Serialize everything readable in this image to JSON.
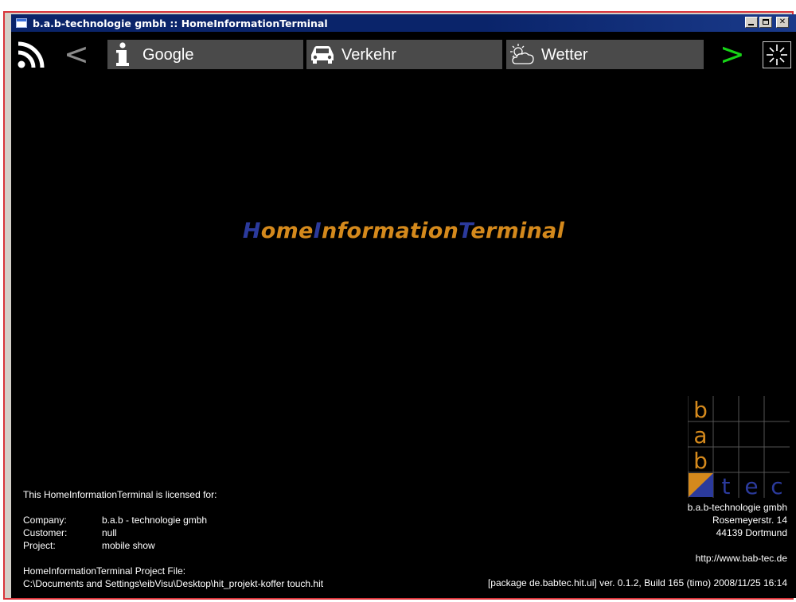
{
  "window": {
    "title": "b.a.b-technologie gmbh :: HomeInformationTerminal"
  },
  "navbar": {
    "back_icon": "chevron-left-icon",
    "forward_icon": "chevron-right-icon",
    "tabs": [
      {
        "label": "Google",
        "icon": "info-icon"
      },
      {
        "label": "Verkehr",
        "icon": "car-icon"
      },
      {
        "label": "Wetter",
        "icon": "weather-cloud-sun-icon"
      }
    ]
  },
  "splash": {
    "title_parts": [
      "H",
      "ome",
      "I",
      "nformation",
      "T",
      "erminal"
    ]
  },
  "logo": {
    "letters": [
      "b",
      "a",
      "b",
      "t",
      "e",
      "c"
    ]
  },
  "license": {
    "intro": "This HomeInformationTerminal is licensed for:",
    "rows": [
      {
        "key": "Company:",
        "value": "b.a.b - technologie gmbh"
      },
      {
        "key": "Customer:",
        "value": "null"
      },
      {
        "key": "Project:",
        "value": "mobile show"
      }
    ],
    "project_file_label": "HomeInformationTerminal Project File:",
    "project_file_path": "C:\\Documents and Settings\\eibVisu\\Desktop\\hit_projekt-koffer touch.hit"
  },
  "company": {
    "name": "b.a.b-technologie gmbh",
    "street": "Rosemeyerstr. 14",
    "city": "44139 Dortmund",
    "url": "http://www.bab-tec.de"
  },
  "build_info": "[package de.babtec.hit.ui] ver. 0.1.2, Build 165 (timo) 2008/11/25 16:14",
  "colors": {
    "accent_blue": "#2b3a9c",
    "accent_orange": "#d4891c",
    "forward_green": "#17d417",
    "tab_bg": "#4a4a4a"
  }
}
